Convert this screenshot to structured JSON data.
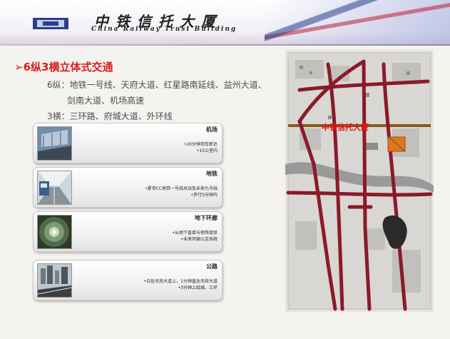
{
  "header": {
    "title": "中铁信托大厦",
    "subtitle": "China Railway Trust Building"
  },
  "heading": "6纵3横立体式交通",
  "vertical_line1": "6纵：地铁一号线、天府大道、红星路南延线、益州大道、",
  "vertical_line2": "剑南大道、机场高速",
  "horizontal_line": "3横：三环路、府城大道、外环线",
  "cards": [
    {
      "title": "机场",
      "lines": [
        "•20分钟到车即达",
        "•15公里内"
      ],
      "icon": "airport-photo"
    },
    {
      "title": "地铁",
      "lines": [
        "•紧邻CC地铁一号线总站及未来九号线",
        "•步行5分钟内"
      ],
      "icon": "metro-photo"
    },
    {
      "title": "地下环廊",
      "lines": [
        "•从地下直接与地铁接驳",
        "•未来环廊公交系统"
      ],
      "icon": "tunnel-photo"
    },
    {
      "title": "公路",
      "lines": [
        "•位处天府大道上，1分钟直达天府大道",
        "•3分钟上绕城、三环"
      ],
      "icon": "highway-photo"
    }
  ],
  "map": {
    "label": "中铁信托大厦",
    "colors": {
      "road": "#8b1a2b",
      "river": "#9a9a9a",
      "ring": "#8b5a1a",
      "site": "#e0781a"
    }
  }
}
